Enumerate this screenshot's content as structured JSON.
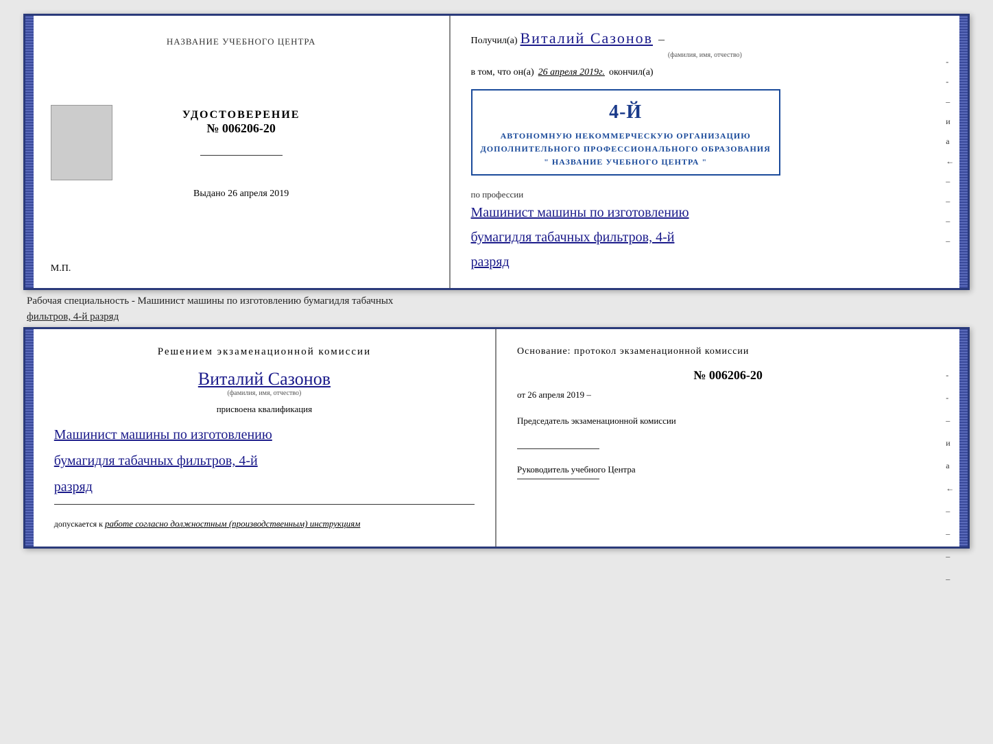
{
  "top_cert": {
    "left": {
      "training_center": "НАЗВАНИЕ УЧЕБНОГО ЦЕНТРА",
      "cert_word": "УДОСТОВЕРЕНИЕ",
      "cert_number": "№ 006206-20",
      "issued_label": "Выдано",
      "issued_date": "26 апреля 2019",
      "mp_label": "М.П."
    },
    "right": {
      "received_label": "Получил(а)",
      "person_name": "Виталий Сазонов",
      "name_subtitle": "(фамилия, имя, отчество)",
      "dash": "–",
      "vtom_label": "в том, что он(а)",
      "vtom_date": "26 апреля 2019г.",
      "finished_label": "окончил(а)",
      "stamp_line1": "АВТОНОМНУЮ НЕКОММЕРЧЕСКУЮ ОРГАНИЗАЦИЮ",
      "stamp_line2": "ДОПОЛНИТЕЛЬНОГО ПРОФЕССИОНАЛЬНОГО ОБРАЗОВАНИЯ",
      "stamp_line3": "\" НАЗВАНИЕ УЧЕБНОГО ЦЕНТРА \"",
      "stamp_number": "4-й",
      "profession_label": "по профессии",
      "profession_line1": "Машинист машины по изготовлению",
      "profession_line2": "бумагидля табачных фильтров, 4-й",
      "profession_line3": "разряд"
    },
    "right_dashes": [
      "-",
      "-",
      "–",
      "и",
      "а",
      "←",
      "–",
      "–",
      "–",
      "–"
    ]
  },
  "info_text": {
    "line1": "Рабочая специальность - Машинист машины по изготовлению бумагидля табачных",
    "line2_underline": "фильтров, 4-й разряд"
  },
  "bottom_cert": {
    "left": {
      "title": "Решением экзаменационной комиссии",
      "person_name": "Виталий Сазонов",
      "name_subtitle": "(фамилия, имя, отчество)",
      "qual_assigned": "присвоена квалификация",
      "qual_line1": "Машинист машины по изготовлению",
      "qual_line2": "бумагидля табачных фильтров, 4-й",
      "qual_line3": "разряд",
      "allowed_prefix": "допускается к",
      "allowed_text": "работе согласно должностным (производственным) инструкциям"
    },
    "right": {
      "basis_label": "Основание: протокол экзаменационной комиссии",
      "protocol_number": "№  006206-20",
      "from_label": "от",
      "from_date": "26 апреля 2019",
      "chairman_label": "Председатель экзаменационной комиссии",
      "director_label": "Руководитель учебного Центра"
    },
    "right_dashes": [
      "-",
      "-",
      "–",
      "и",
      "а",
      "←",
      "–",
      "–",
      "–",
      "–"
    ]
  }
}
